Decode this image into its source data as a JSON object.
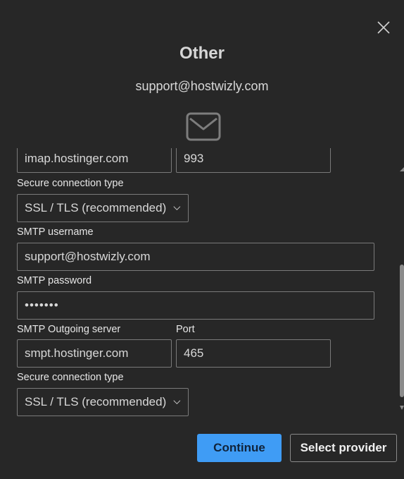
{
  "dialog": {
    "title": "Other",
    "email": "support@hostwizly.com"
  },
  "icons": {
    "close": "close-icon",
    "mail": "envelope-icon",
    "dropdown": "chevron-down-icon"
  },
  "form": {
    "incoming_server_partial": "imap.hostinger.com",
    "incoming_port_partial": "993",
    "incoming_secure_label": "Secure connection type",
    "incoming_secure_value": "SSL / TLS (recommended)",
    "smtp_username_label": "SMTP username",
    "smtp_username_value": "support@hostwizly.com",
    "smtp_password_label": "SMTP password",
    "smtp_password_value": "•••••••",
    "smtp_server_label": "SMTP Outgoing server",
    "smtp_server_value": "smpt.hostinger.com",
    "smtp_port_label": "Port",
    "smtp_port_value": "465",
    "outgoing_secure_label": "Secure connection type",
    "outgoing_secure_value": "SSL / TLS (recommended)"
  },
  "buttons": {
    "continue": "Continue",
    "select_provider": "Select provider"
  },
  "colors": {
    "background": "#272727",
    "accent": "#3f9cf5",
    "border": "#7a7a7a"
  }
}
